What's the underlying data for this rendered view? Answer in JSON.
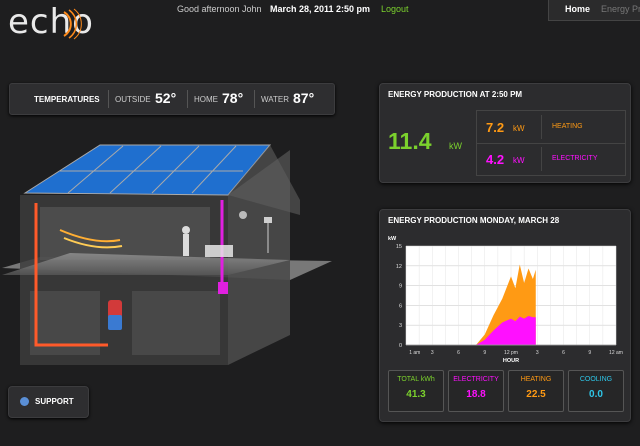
{
  "header": {
    "logo": "echo",
    "greeting": "Good afternoon John",
    "datetime": "March 28, 2011 2:50 pm",
    "logout": "Logout",
    "nav": [
      "Home",
      "Energy Pro"
    ]
  },
  "temperatures": {
    "label": "TEMPERATURES",
    "outside_label": "OUTSIDE",
    "outside_value": "52°",
    "home_label": "HOME",
    "home_value": "78°",
    "water_label": "WATER",
    "water_value": "87°"
  },
  "production_now": {
    "title": "ENERGY PRODUCTION AT 2:50 PM",
    "total": "11.4",
    "total_unit": "kW",
    "heating_value": "7.2",
    "heating_unit": "kW",
    "heating_label": "HEATING",
    "electricity_value": "4.2",
    "electricity_unit": "kW",
    "electricity_label": "ELECTRICITY"
  },
  "production_day": {
    "title": "ENERGY PRODUCTION MONDAY, MARCH 28",
    "stats": [
      {
        "label": "TOTAL kWh",
        "value": "41.3"
      },
      {
        "label": "ELECTRICITY",
        "value": "18.8"
      },
      {
        "label": "HEATING",
        "value": "22.5"
      },
      {
        "label": "COOLING",
        "value": "0.0"
      }
    ]
  },
  "chart_data": {
    "type": "area",
    "ylabel": "kW",
    "xlabel": "HOUR",
    "ylim": [
      0,
      15
    ],
    "xlim": [
      0,
      24
    ],
    "y_ticks": [
      "0",
      "3",
      "6",
      "9",
      "12",
      "15"
    ],
    "x_ticks": [
      "1 am",
      "3",
      "6",
      "9",
      "12 pm",
      "3",
      "6",
      "9",
      "12 am"
    ],
    "grid": true,
    "x": [
      8,
      9,
      10,
      11,
      12,
      12.5,
      13,
      13.5,
      14,
      14.5,
      14.83
    ],
    "series": [
      {
        "name": "",
        "values": [
          0,
          0.8,
          2.2,
          3.4,
          4.0,
          3.6,
          4.3,
          4.0,
          4.4,
          4.2,
          4.2
        ],
        "color": "#ff10ff"
      },
      {
        "name": "",
        "values": [
          0,
          1.6,
          4.5,
          7.0,
          10.4,
          8.6,
          12.2,
          9.4,
          11.6,
          10.0,
          11.4
        ],
        "color": "#ff9a14"
      }
    ]
  },
  "support": {
    "label": "SUPPORT"
  },
  "colors": {
    "green": "#7bd12d",
    "orange": "#ff9a14",
    "magenta": "#ff10ff",
    "cyan": "#2ec6e8"
  }
}
